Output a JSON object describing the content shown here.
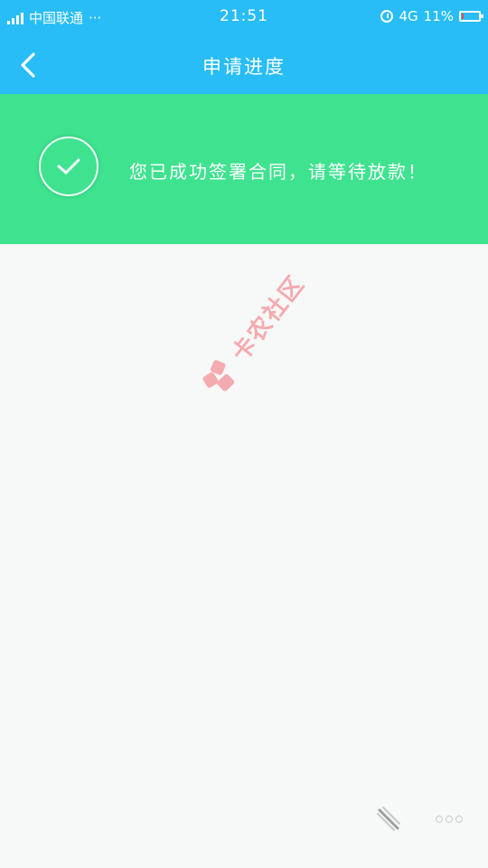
{
  "status_bar": {
    "network_tag": "4G",
    "carrier": "中国联通",
    "more": "···",
    "time": "21:51",
    "data_type": "4G",
    "battery": "11%",
    "battery_level": 0.11
  },
  "nav": {
    "title": "申请进度"
  },
  "banner": {
    "message": "您已成功签署合同，请等待放款！",
    "color": "#3fe38f"
  },
  "watermark": {
    "text": "卡农社区"
  },
  "colors": {
    "header": "#28bdf6",
    "background": "#f7f8f8"
  }
}
